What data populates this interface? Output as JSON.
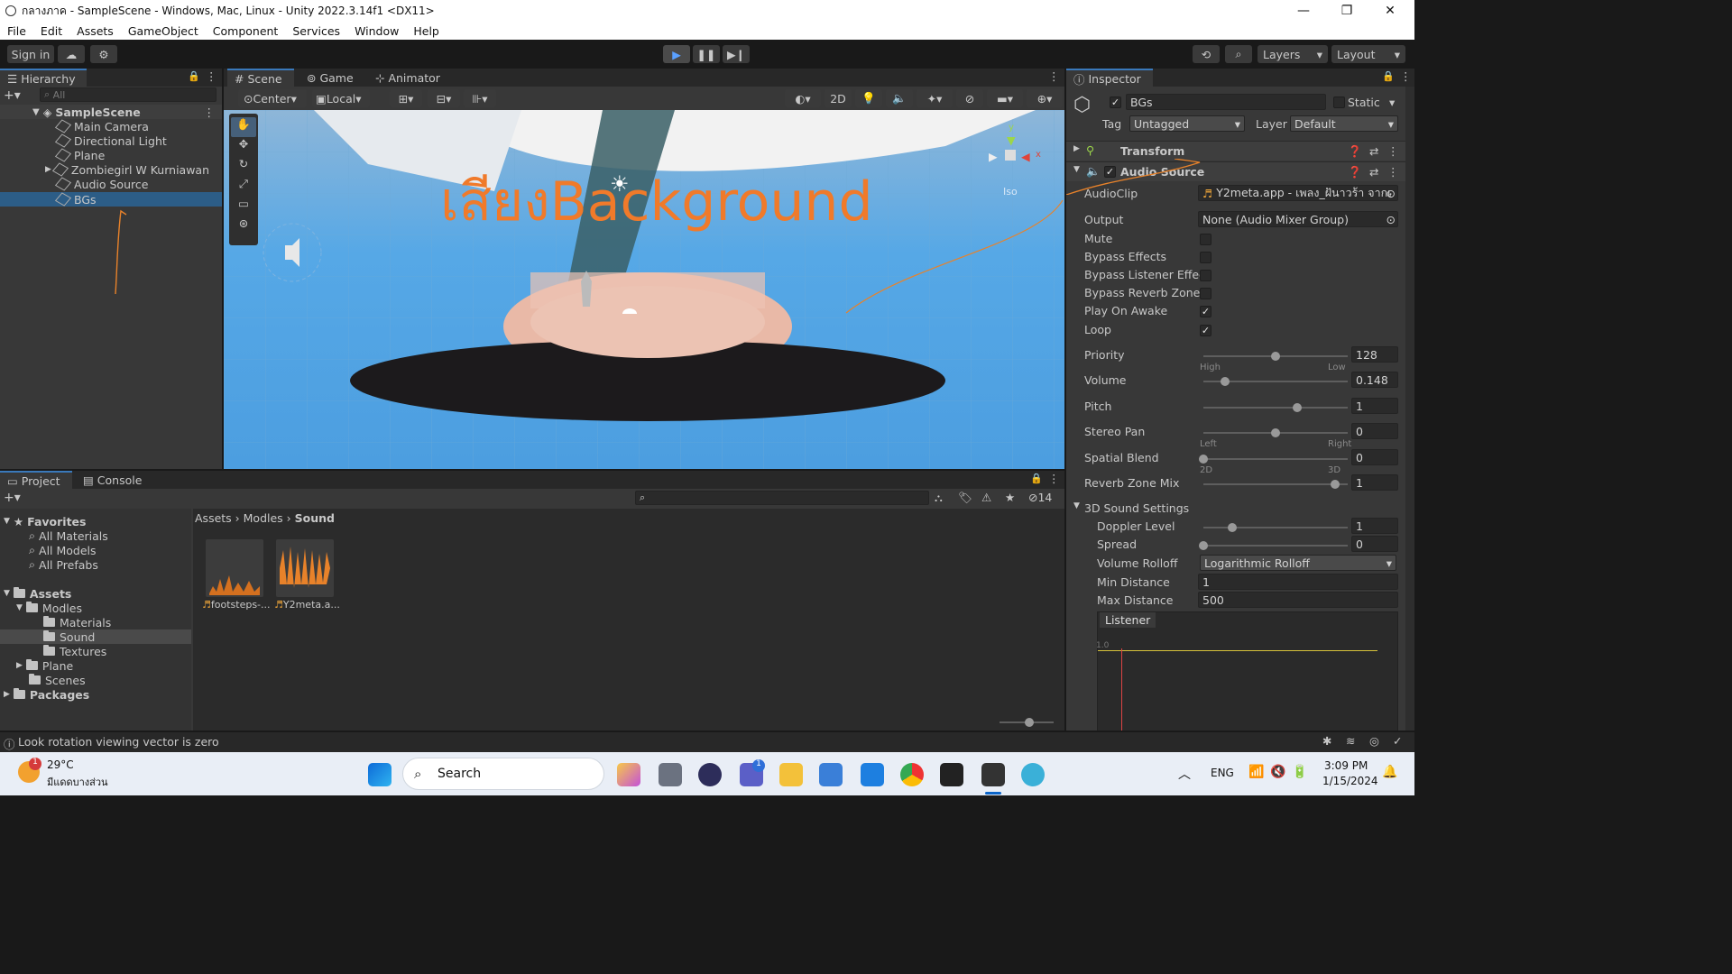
{
  "window": {
    "title": "กลางภาค - SampleScene - Windows, Mac, Linux - Unity 2022.3.14f1 <DX11>"
  },
  "menu": [
    "File",
    "Edit",
    "Assets",
    "GameObject",
    "Component",
    "Services",
    "Window",
    "Help"
  ],
  "toolbar": {
    "sign_in": "Sign in",
    "layers": "Layers",
    "layout": "Layout"
  },
  "hierarchy": {
    "tab": "Hierarchy",
    "search_placeholder": "All",
    "scene": "SampleScene",
    "items": [
      "Main Camera",
      "Directional Light",
      "Plane",
      "Zombiegirl W Kurniawan",
      "Audio Source",
      "BGs"
    ],
    "selected": "BGs"
  },
  "scene_view": {
    "tabs": [
      "Scene",
      "Game",
      "Animator"
    ],
    "pivot": "Center",
    "space": "Local",
    "mode_2d": "2D",
    "overlay_text": "เสียงBackground",
    "persp_label": "Iso",
    "gizmo_axes": {
      "y": "y",
      "x": "x"
    }
  },
  "inspector": {
    "tab": "Inspector",
    "object_name": "BGs",
    "static_label": "Static",
    "tag_label": "Tag",
    "tag_value": "Untagged",
    "layer_label": "Layer",
    "layer_value": "Default",
    "transform_label": "Transform",
    "audio_source_label": "Audio Source",
    "audio_clip_label": "AudioClip",
    "audio_clip_value": "Y2meta.app - เพลง_ฝันาวร้า จากเ",
    "output_label": "Output",
    "output_value": "None (Audio Mixer Group)",
    "toggles": [
      {
        "label": "Mute",
        "checked": false
      },
      {
        "label": "Bypass Effects",
        "checked": false
      },
      {
        "label": "Bypass Listener Effec",
        "checked": false
      },
      {
        "label": "Bypass Reverb Zones",
        "checked": false
      },
      {
        "label": "Play On Awake",
        "checked": true
      },
      {
        "label": "Loop",
        "checked": true
      }
    ],
    "sliders": [
      {
        "label": "Priority",
        "value": "128",
        "fraction": 0.5,
        "left": "High",
        "right": "Low"
      },
      {
        "label": "Volume",
        "value": "0.148",
        "fraction": 0.148,
        "left": "",
        "right": ""
      },
      {
        "label": "Pitch",
        "value": "1",
        "fraction": 0.65,
        "left": "",
        "right": ""
      },
      {
        "label": "Stereo Pan",
        "value": "0",
        "fraction": 0.5,
        "left": "Left",
        "right": "Right"
      },
      {
        "label": "Spatial Blend",
        "value": "0",
        "fraction": 0.0,
        "left": "2D",
        "right": "3D"
      },
      {
        "label": "Reverb Zone Mix",
        "value": "1",
        "fraction": 0.91,
        "left": "",
        "right": ""
      }
    ],
    "sound3d_label": "3D Sound Settings",
    "sound3d": [
      {
        "label": "Doppler Level",
        "value": "1",
        "fraction": 0.2
      },
      {
        "label": "Spread",
        "value": "0",
        "fraction": 0.0
      }
    ],
    "rolloff_label": "Volume Rolloff",
    "rolloff_value": "Logarithmic Rolloff",
    "min_distance_label": "Min Distance",
    "min_distance_value": "1",
    "max_distance_label": "Max Distance",
    "max_distance_value": "500",
    "listener_label": "Listener",
    "graph_y_label": "1.0"
  },
  "project": {
    "tabs": [
      "Project",
      "Console"
    ],
    "favorites_label": "Favorites",
    "favorites": [
      "All Materials",
      "All Models",
      "All Prefabs"
    ],
    "assets_label": "Assets",
    "tree": [
      {
        "label": "Modles",
        "indent": 1,
        "open": true
      },
      {
        "label": "Materials",
        "indent": 2
      },
      {
        "label": "Sound",
        "indent": 2,
        "selected": true
      },
      {
        "label": "Textures",
        "indent": 2
      },
      {
        "label": "Plane",
        "indent": 1
      },
      {
        "label": "Scenes",
        "indent": 1
      }
    ],
    "packages_label": "Packages",
    "breadcrumb": [
      "Assets",
      "Modles",
      "Sound"
    ],
    "hidden_count": "14",
    "files": [
      "footsteps-...",
      "Y2meta.a..."
    ]
  },
  "status": {
    "message": "Look rotation viewing vector is zero"
  },
  "taskbar": {
    "weather_temp": "29°C",
    "weather_desc": "มีแดดบางส่วน",
    "search": "Search",
    "lang": "ENG",
    "time": "3:09 PM",
    "date": "1/15/2024",
    "teams_badge": "1",
    "weather_badge": "1"
  },
  "colors": {
    "accent": "#3a79bb",
    "annotation": "#e8822a",
    "sky": "#56a8e6"
  }
}
